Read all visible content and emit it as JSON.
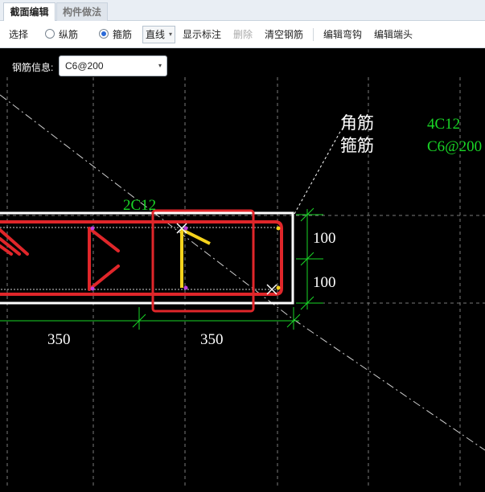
{
  "tabs": [
    {
      "label": "截面编辑",
      "active": true
    },
    {
      "label": "构件做法",
      "active": false
    }
  ],
  "toolbar": {
    "select_label": "选择",
    "longitudinal_label": "纵筋",
    "stirrup_label": "箍筋",
    "selected_mode": "箍筋",
    "line_mode": "直线",
    "show_annotation_label": "显示标注",
    "delete_label": "删除",
    "clear_rebar_label": "清空钢筋",
    "edit_hook_label": "编辑弯钩",
    "edit_end_label": "编辑端头"
  },
  "rebar_info": {
    "label": "钢筋信息:",
    "value": "C6@200"
  },
  "drawing": {
    "legend": [
      {
        "name": "角筋",
        "value": "4C12"
      },
      {
        "name": "箍筋",
        "value": "C6@200"
      }
    ],
    "rebar_label": "2C12",
    "dim_vertical": [
      "100",
      "100"
    ],
    "dim_horizontal": [
      "350",
      "350"
    ],
    "colors": {
      "background": "#000000",
      "grid": "#7a7a7a",
      "section_outline": "#ffffff",
      "stirrup": "#e0262a",
      "selection_box": "#e0262a",
      "dimension": "#19d626",
      "legend_value": "#19d626",
      "legend_name": "#ffffff",
      "highlight_rebar": "#f5d31c"
    }
  }
}
